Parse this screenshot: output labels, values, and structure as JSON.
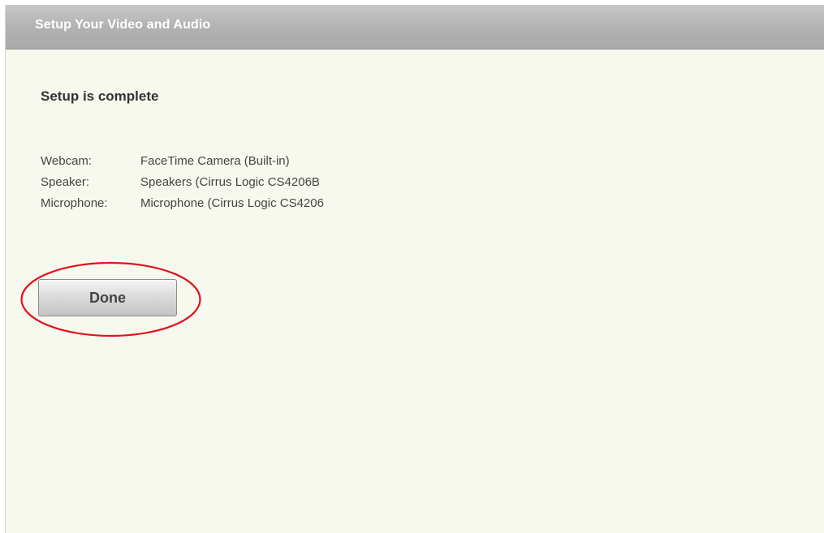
{
  "window": {
    "title": "Setup Your Video and Audio"
  },
  "main": {
    "heading": "Setup is complete",
    "devices": [
      {
        "label": "Webcam:",
        "value": "FaceTime Camera (Built-in)"
      },
      {
        "label": "Speaker:",
        "value": "Speakers (Cirrus Logic CS4206B"
      },
      {
        "label": "Microphone:",
        "value": "Microphone (Cirrus Logic CS4206"
      }
    ],
    "done_label": "Done"
  },
  "colors": {
    "background": "#f7f9ef",
    "titlebar": "#b1b1b1",
    "annotation_ring": "#e0141c"
  }
}
